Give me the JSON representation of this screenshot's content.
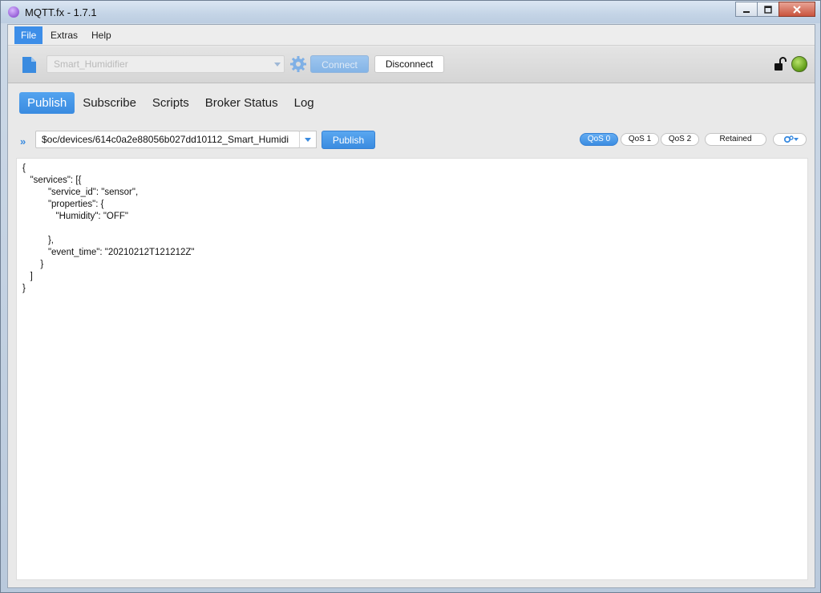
{
  "window": {
    "title": "MQTT.fx - 1.7.1",
    "controls": [
      "minimize",
      "maximize",
      "close"
    ]
  },
  "menu": {
    "items": [
      {
        "label": "File",
        "active": true
      },
      {
        "label": "Extras",
        "active": false
      },
      {
        "label": "Help",
        "active": false
      }
    ]
  },
  "toolbar": {
    "profile_value": "Smart_Humidifier",
    "connect_label": "Connect",
    "disconnect_label": "Disconnect",
    "connection_status_color": "#5e9b16"
  },
  "tabs": [
    {
      "label": "Publish",
      "active": true
    },
    {
      "label": "Subscribe",
      "active": false
    },
    {
      "label": "Scripts",
      "active": false
    },
    {
      "label": "Broker Status",
      "active": false
    },
    {
      "label": "Log",
      "active": false
    }
  ],
  "publish": {
    "topic": "$oc/devices/614c0a2e88056b027dd10112_Smart_Humidi",
    "publish_label": "Publish",
    "qos": [
      {
        "label": "QoS 0",
        "active": true
      },
      {
        "label": "QoS 1",
        "active": false
      },
      {
        "label": "QoS 2",
        "active": false
      }
    ],
    "retained_label": "Retained",
    "payload": "{\n   \"services\": [{\n          \"service_id\": \"sensor\",\n          \"properties\": {\n             \"Humidity\": \"OFF\"\n\n          },\n          \"event_time\": \"20210212T121212Z\"\n       }\n   ]\n}"
  },
  "colors": {
    "accent": "#3a8be0",
    "window_bg": "#e9e9e9"
  }
}
